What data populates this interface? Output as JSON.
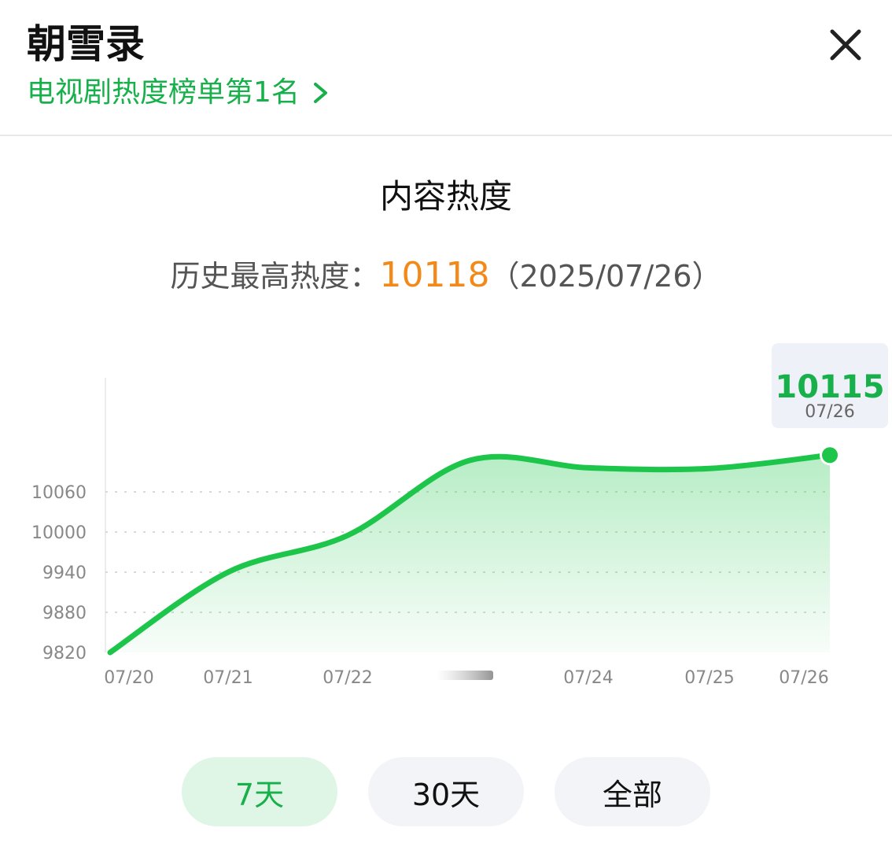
{
  "header": {
    "title": "朝雪录",
    "rank_text": "电视剧热度榜单第1名",
    "close_icon": "close-icon",
    "chevron_icon": "chevron-right-icon"
  },
  "section": {
    "title": "内容热度",
    "peak_label": "历史最高热度：",
    "peak_value": "10118",
    "peak_date": "（2025/07/26）"
  },
  "colors": {
    "accent": "#17b04a",
    "line": "#1dc64a",
    "peak": "#f28a1a",
    "tab_active_bg": "#dff6e6",
    "tab_bg": "#f3f4f7"
  },
  "chart_data": {
    "type": "area",
    "title": "",
    "xlabel": "",
    "ylabel": "",
    "y_ticks": [
      9820,
      9880,
      9940,
      10000,
      10060
    ],
    "x_ticks": [
      "07/20",
      "07/21",
      "07/22",
      "",
      "07/24",
      "07/25",
      "07/26"
    ],
    "ylim": [
      9820,
      10115
    ],
    "grid": true,
    "series": [
      {
        "values": [
          9820,
          9940,
          9995,
          10107,
          10096,
          10095,
          10115
        ]
      }
    ],
    "tooltip": {
      "value": "10115",
      "date": "07/26"
    }
  },
  "tabs": [
    {
      "label": "7天",
      "active": true
    },
    {
      "label": "30天",
      "active": false
    },
    {
      "label": "全部",
      "active": false
    }
  ]
}
